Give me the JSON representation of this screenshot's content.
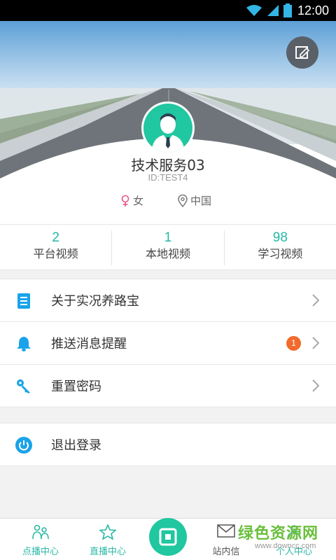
{
  "status_bar": {
    "time": "12:00"
  },
  "profile": {
    "name": "技术服务03",
    "id": "ID:TEST4",
    "gender": "女",
    "location": "中国"
  },
  "stats": [
    {
      "value": "2",
      "label": "平台视频"
    },
    {
      "value": "1",
      "label": "本地视频"
    },
    {
      "value": "98",
      "label": "学习视频"
    }
  ],
  "menu": {
    "items": [
      {
        "label": "关于实况养路宝",
        "icon": "document-icon"
      },
      {
        "label": "推送消息提醒",
        "icon": "bell-icon",
        "badge": "1"
      },
      {
        "label": "重置密码",
        "icon": "key-icon"
      }
    ],
    "logout": {
      "label": "退出登录",
      "icon": "power-icon"
    }
  },
  "bottom_nav": [
    {
      "label": "点播中心",
      "icon": "people-icon"
    },
    {
      "label": "直播中心",
      "icon": "star-icon"
    },
    {
      "label": "",
      "icon": "camera-icon"
    },
    {
      "label": "站内信",
      "icon": "mail-icon"
    },
    {
      "label": "个人中心",
      "icon": "person-icon"
    }
  ],
  "watermark": {
    "title": "绿色资源网",
    "url": "www.downcc.com"
  },
  "colors": {
    "accent": "#20c7a0",
    "text_accent": "#24b8a5",
    "icon_blue": "#1aa3e8",
    "badge": "#f26b2d",
    "female": "#e8578a"
  }
}
